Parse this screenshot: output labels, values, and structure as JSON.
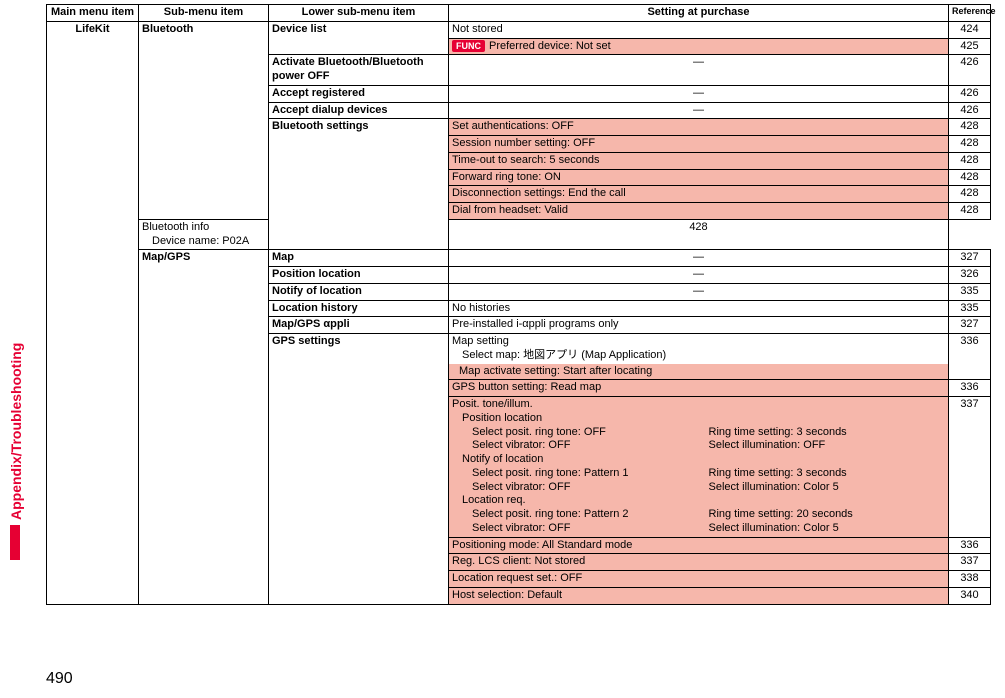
{
  "sideTab": "Appendix/Troubleshooting",
  "pageNumber": "490",
  "headers": {
    "main": "Main menu item",
    "sub": "Sub-menu item",
    "lower": "Lower sub-menu item",
    "setting": "Setting at purchase",
    "reference": "Reference"
  },
  "mainItem": "LifeKit",
  "bluetooth": {
    "name": "Bluetooth",
    "deviceList": {
      "label": "Device list",
      "notStored": "Not stored",
      "notStoredRef": "424",
      "funcBadge": "FUNC",
      "preferred": "Preferred device: Not set",
      "preferredRef": "425"
    },
    "activate": {
      "label": "Activate Bluetooth/Bluetooth power OFF",
      "setting": "―",
      "ref": "426"
    },
    "acceptReg": {
      "label": "Accept registered",
      "setting": "―",
      "ref": "426"
    },
    "acceptDial": {
      "label": "Accept dialup devices",
      "setting": "―",
      "ref": "426"
    },
    "settings": {
      "label": "Bluetooth settings",
      "rows": [
        {
          "text": "Set authentications: OFF",
          "ref": "428",
          "hl": true
        },
        {
          "text": "Session number setting: OFF",
          "ref": "428",
          "hl": true
        },
        {
          "text": "Time-out to search: 5 seconds",
          "ref": "428",
          "hl": true
        },
        {
          "text": "Forward ring tone: ON",
          "ref": "428",
          "hl": true
        },
        {
          "text": "Disconnection settings: End the call",
          "ref": "428",
          "hl": true
        },
        {
          "text": "Dial from headset: Valid",
          "ref": "428",
          "hl": true
        }
      ],
      "info": {
        "line1": "Bluetooth info",
        "line2": "Device name: P02A",
        "ref": "428"
      }
    }
  },
  "mapgps": {
    "name": "Map/GPS",
    "map": {
      "label": "Map",
      "setting": "―",
      "ref": "327"
    },
    "posLoc": {
      "label": "Position location",
      "setting": "―",
      "ref": "326"
    },
    "notify": {
      "label": "Notify of location",
      "setting": "―",
      "ref": "335"
    },
    "history": {
      "label": "Location history",
      "setting": "No histories",
      "ref": "335"
    },
    "appli": {
      "label": "Map/GPS αppli",
      "setting": "Pre-installed i-αppli programs only",
      "ref": "327"
    },
    "gpsSettings": {
      "label": "GPS settings",
      "mapSetting": {
        "line1": "Map setting",
        "line2": "Select map: 地図アプリ (Map Application)",
        "line3": "Map activate setting: Start after locating",
        "ref": "336"
      },
      "gpsButton": {
        "text": "GPS button setting: Read map",
        "ref": "336"
      },
      "positTone": {
        "title": "Posit. tone/illum.",
        "ref": "337",
        "posLocHeader": "Position location",
        "posLoc_ring": "Select posit. ring tone: OFF",
        "posLoc_ringTime": "Ring time setting: 3 seconds",
        "posLoc_vib": "Select vibrator: OFF",
        "posLoc_illum": "Select illumination: OFF",
        "notifyHeader": "Notify of location",
        "notify_ring": "Select posit. ring tone: Pattern 1",
        "notify_ringTime": "Ring time setting: 3 seconds",
        "notify_vib": "Select vibrator: OFF",
        "notify_illum": "Select illumination: Color 5",
        "locReqHeader": "Location req.",
        "locReq_ring": "Select posit. ring tone: Pattern 2",
        "locReq_ringTime": "Ring time setting: 20 seconds",
        "locReq_vib": "Select vibrator: OFF",
        "locReq_illum": "Select illumination: Color 5"
      },
      "posMode": {
        "text": "Positioning mode: All Standard mode",
        "ref": "336"
      },
      "regLcs": {
        "text": "Reg. LCS client: Not stored",
        "ref": "337"
      },
      "locReqSet": {
        "text": "Location request set.: OFF",
        "ref": "338"
      },
      "hostSel": {
        "text": "Host selection: Default",
        "ref": "340"
      }
    }
  }
}
